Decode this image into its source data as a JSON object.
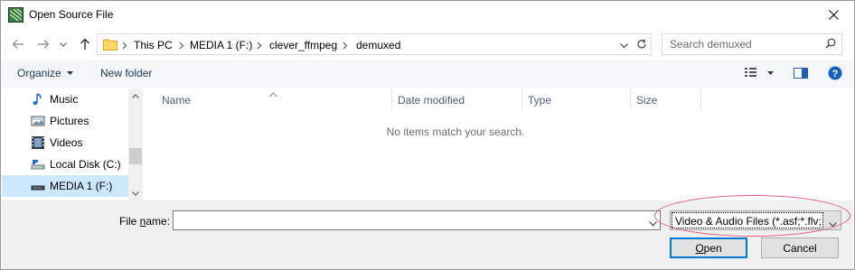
{
  "window": {
    "title": "Open Source File",
    "app_icon": "film-app-icon",
    "close_icon": "close-icon"
  },
  "navigation": {
    "back_icon": "back-arrow-icon",
    "forward_icon": "forward-arrow-icon",
    "recent_icon": "chevron-down-icon",
    "up_icon": "up-arrow-icon"
  },
  "address": {
    "breadcrumbs": [
      "This PC",
      "MEDIA 1 (F:)",
      "clever_ffmpeg",
      "demuxed"
    ]
  },
  "search": {
    "placeholder": "Search demuxed"
  },
  "toolbar": {
    "organize_label": "Organize",
    "new_folder_label": "New folder"
  },
  "nav_pane": {
    "items": [
      {
        "label": "Music",
        "icon": "music-note-icon"
      },
      {
        "label": "Pictures",
        "icon": "pictures-icon"
      },
      {
        "label": "Videos",
        "icon": "videos-icon"
      },
      {
        "label": "Local Disk (C:)",
        "icon": "local-disk-icon"
      },
      {
        "label": "MEDIA 1 (F:)",
        "icon": "removable-drive-icon",
        "selected": true
      }
    ]
  },
  "file_list": {
    "columns": [
      "Name",
      "Date modified",
      "Type",
      "Size"
    ],
    "empty_message": "No items match your search."
  },
  "bottom": {
    "file_name_label": "File name:",
    "file_name_label_prefix": "File ",
    "file_name_label_accel": "n",
    "file_name_label_suffix": "ame:",
    "file_name_value": "",
    "file_type_selected": "Video & Audio Files (*.asf;*.flv;",
    "open_label": "Open",
    "open_accel": "O",
    "open_rest": "pen",
    "cancel_label": "Cancel"
  },
  "colors": {
    "selection": "#cce8ff",
    "accent": "#0078d7",
    "annotation": "#e5557a"
  }
}
